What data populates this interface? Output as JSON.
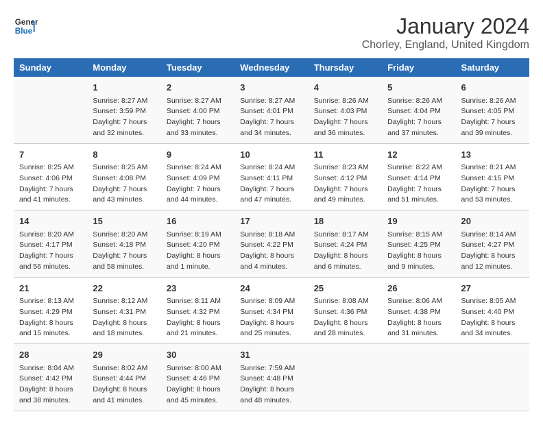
{
  "header": {
    "logo_line1": "General",
    "logo_line2": "Blue",
    "month": "January 2024",
    "location": "Chorley, England, United Kingdom"
  },
  "weekdays": [
    "Sunday",
    "Monday",
    "Tuesday",
    "Wednesday",
    "Thursday",
    "Friday",
    "Saturday"
  ],
  "weeks": [
    [
      {
        "day": "",
        "sunrise": "",
        "sunset": "",
        "daylight": ""
      },
      {
        "day": "1",
        "sunrise": "Sunrise: 8:27 AM",
        "sunset": "Sunset: 3:59 PM",
        "daylight": "Daylight: 7 hours and 32 minutes."
      },
      {
        "day": "2",
        "sunrise": "Sunrise: 8:27 AM",
        "sunset": "Sunset: 4:00 PM",
        "daylight": "Daylight: 7 hours and 33 minutes."
      },
      {
        "day": "3",
        "sunrise": "Sunrise: 8:27 AM",
        "sunset": "Sunset: 4:01 PM",
        "daylight": "Daylight: 7 hours and 34 minutes."
      },
      {
        "day": "4",
        "sunrise": "Sunrise: 8:26 AM",
        "sunset": "Sunset: 4:03 PM",
        "daylight": "Daylight: 7 hours and 36 minutes."
      },
      {
        "day": "5",
        "sunrise": "Sunrise: 8:26 AM",
        "sunset": "Sunset: 4:04 PM",
        "daylight": "Daylight: 7 hours and 37 minutes."
      },
      {
        "day": "6",
        "sunrise": "Sunrise: 8:26 AM",
        "sunset": "Sunset: 4:05 PM",
        "daylight": "Daylight: 7 hours and 39 minutes."
      }
    ],
    [
      {
        "day": "7",
        "sunrise": "Sunrise: 8:25 AM",
        "sunset": "Sunset: 4:06 PM",
        "daylight": "Daylight: 7 hours and 41 minutes."
      },
      {
        "day": "8",
        "sunrise": "Sunrise: 8:25 AM",
        "sunset": "Sunset: 4:08 PM",
        "daylight": "Daylight: 7 hours and 43 minutes."
      },
      {
        "day": "9",
        "sunrise": "Sunrise: 8:24 AM",
        "sunset": "Sunset: 4:09 PM",
        "daylight": "Daylight: 7 hours and 44 minutes."
      },
      {
        "day": "10",
        "sunrise": "Sunrise: 8:24 AM",
        "sunset": "Sunset: 4:11 PM",
        "daylight": "Daylight: 7 hours and 47 minutes."
      },
      {
        "day": "11",
        "sunrise": "Sunrise: 8:23 AM",
        "sunset": "Sunset: 4:12 PM",
        "daylight": "Daylight: 7 hours and 49 minutes."
      },
      {
        "day": "12",
        "sunrise": "Sunrise: 8:22 AM",
        "sunset": "Sunset: 4:14 PM",
        "daylight": "Daylight: 7 hours and 51 minutes."
      },
      {
        "day": "13",
        "sunrise": "Sunrise: 8:21 AM",
        "sunset": "Sunset: 4:15 PM",
        "daylight": "Daylight: 7 hours and 53 minutes."
      }
    ],
    [
      {
        "day": "14",
        "sunrise": "Sunrise: 8:20 AM",
        "sunset": "Sunset: 4:17 PM",
        "daylight": "Daylight: 7 hours and 56 minutes."
      },
      {
        "day": "15",
        "sunrise": "Sunrise: 8:20 AM",
        "sunset": "Sunset: 4:18 PM",
        "daylight": "Daylight: 7 hours and 58 minutes."
      },
      {
        "day": "16",
        "sunrise": "Sunrise: 8:19 AM",
        "sunset": "Sunset: 4:20 PM",
        "daylight": "Daylight: 8 hours and 1 minute."
      },
      {
        "day": "17",
        "sunrise": "Sunrise: 8:18 AM",
        "sunset": "Sunset: 4:22 PM",
        "daylight": "Daylight: 8 hours and 4 minutes."
      },
      {
        "day": "18",
        "sunrise": "Sunrise: 8:17 AM",
        "sunset": "Sunset: 4:24 PM",
        "daylight": "Daylight: 8 hours and 6 minutes."
      },
      {
        "day": "19",
        "sunrise": "Sunrise: 8:15 AM",
        "sunset": "Sunset: 4:25 PM",
        "daylight": "Daylight: 8 hours and 9 minutes."
      },
      {
        "day": "20",
        "sunrise": "Sunrise: 8:14 AM",
        "sunset": "Sunset: 4:27 PM",
        "daylight": "Daylight: 8 hours and 12 minutes."
      }
    ],
    [
      {
        "day": "21",
        "sunrise": "Sunrise: 8:13 AM",
        "sunset": "Sunset: 4:29 PM",
        "daylight": "Daylight: 8 hours and 15 minutes."
      },
      {
        "day": "22",
        "sunrise": "Sunrise: 8:12 AM",
        "sunset": "Sunset: 4:31 PM",
        "daylight": "Daylight: 8 hours and 18 minutes."
      },
      {
        "day": "23",
        "sunrise": "Sunrise: 8:11 AM",
        "sunset": "Sunset: 4:32 PM",
        "daylight": "Daylight: 8 hours and 21 minutes."
      },
      {
        "day": "24",
        "sunrise": "Sunrise: 8:09 AM",
        "sunset": "Sunset: 4:34 PM",
        "daylight": "Daylight: 8 hours and 25 minutes."
      },
      {
        "day": "25",
        "sunrise": "Sunrise: 8:08 AM",
        "sunset": "Sunset: 4:36 PM",
        "daylight": "Daylight: 8 hours and 28 minutes."
      },
      {
        "day": "26",
        "sunrise": "Sunrise: 8:06 AM",
        "sunset": "Sunset: 4:38 PM",
        "daylight": "Daylight: 8 hours and 31 minutes."
      },
      {
        "day": "27",
        "sunrise": "Sunrise: 8:05 AM",
        "sunset": "Sunset: 4:40 PM",
        "daylight": "Daylight: 8 hours and 34 minutes."
      }
    ],
    [
      {
        "day": "28",
        "sunrise": "Sunrise: 8:04 AM",
        "sunset": "Sunset: 4:42 PM",
        "daylight": "Daylight: 8 hours and 38 minutes."
      },
      {
        "day": "29",
        "sunrise": "Sunrise: 8:02 AM",
        "sunset": "Sunset: 4:44 PM",
        "daylight": "Daylight: 8 hours and 41 minutes."
      },
      {
        "day": "30",
        "sunrise": "Sunrise: 8:00 AM",
        "sunset": "Sunset: 4:46 PM",
        "daylight": "Daylight: 8 hours and 45 minutes."
      },
      {
        "day": "31",
        "sunrise": "Sunrise: 7:59 AM",
        "sunset": "Sunset: 4:48 PM",
        "daylight": "Daylight: 8 hours and 48 minutes."
      },
      {
        "day": "",
        "sunrise": "",
        "sunset": "",
        "daylight": ""
      },
      {
        "day": "",
        "sunrise": "",
        "sunset": "",
        "daylight": ""
      },
      {
        "day": "",
        "sunrise": "",
        "sunset": "",
        "daylight": ""
      }
    ]
  ]
}
